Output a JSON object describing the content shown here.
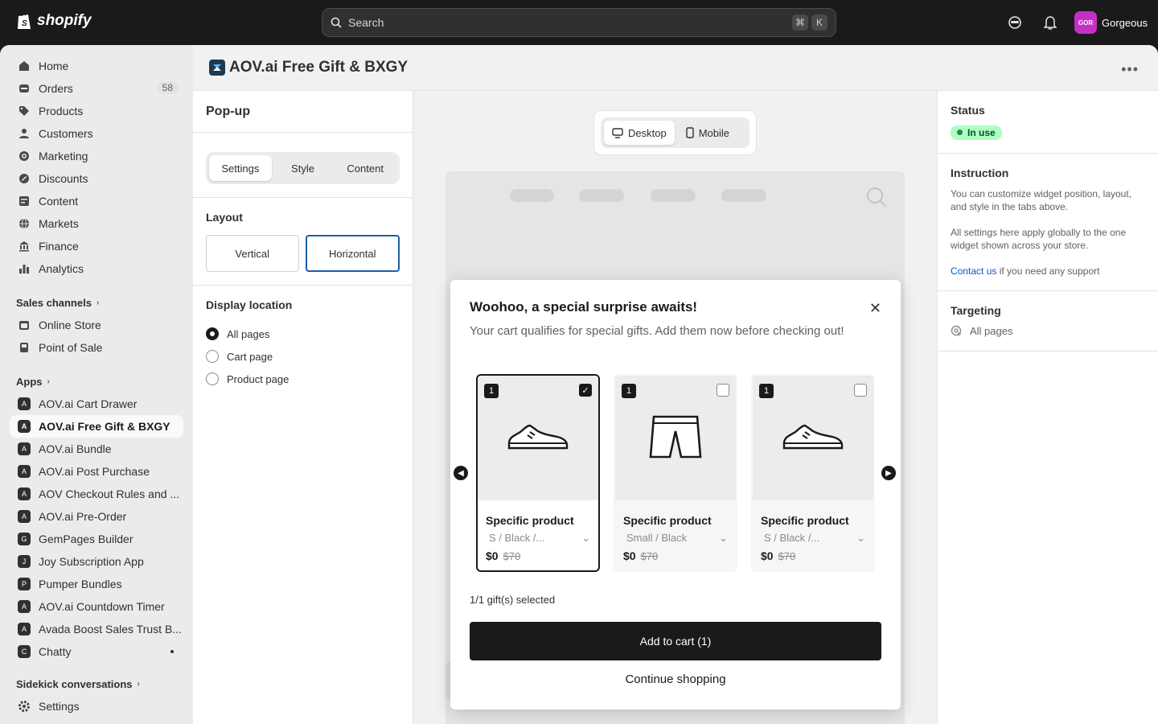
{
  "topbar": {
    "brand": "shopify",
    "search_placeholder": "Search",
    "shortcut_keys": [
      "⌘",
      "K"
    ],
    "store_initials": "GOR",
    "store_name": "Gorgeous",
    "store_color": "#c62fc6"
  },
  "sidebar": {
    "main_items": [
      {
        "label": "Home",
        "icon": "home-icon"
      },
      {
        "label": "Orders",
        "icon": "orders-icon",
        "badge": "58"
      },
      {
        "label": "Products",
        "icon": "tag-icon"
      },
      {
        "label": "Customers",
        "icon": "person-icon"
      },
      {
        "label": "Marketing",
        "icon": "target-icon"
      },
      {
        "label": "Discounts",
        "icon": "discount-icon"
      },
      {
        "label": "Content",
        "icon": "content-icon"
      },
      {
        "label": "Markets",
        "icon": "globe-icon"
      },
      {
        "label": "Finance",
        "icon": "bank-icon"
      },
      {
        "label": "Analytics",
        "icon": "chart-icon"
      }
    ],
    "sales_channels_label": "Sales channels",
    "sales_channels": [
      {
        "label": "Online Store"
      },
      {
        "label": "Point of Sale"
      }
    ],
    "apps_label": "Apps",
    "apps": [
      {
        "label": "AOV.ai Cart Drawer"
      },
      {
        "label": "AOV.ai Free Gift & BXGY"
      },
      {
        "label": "AOV.ai Bundle"
      },
      {
        "label": "AOV.ai Post Purchase"
      },
      {
        "label": "AOV Checkout Rules and ..."
      },
      {
        "label": "AOV.ai Pre-Order"
      },
      {
        "label": "GemPages Builder"
      },
      {
        "label": "Joy Subscription App"
      },
      {
        "label": "Pumper Bundles"
      },
      {
        "label": "AOV.ai Countdown Timer"
      },
      {
        "label": "Avada Boost Sales Trust B..."
      },
      {
        "label": "Chatty"
      }
    ],
    "sidekick_label": "Sidekick conversations",
    "settings_label": "Settings"
  },
  "page": {
    "title": "AOV.ai Free Gift & BXGY"
  },
  "panel": {
    "title": "Pop-up",
    "tabs": [
      "Settings",
      "Style",
      "Content"
    ],
    "active_tab": "Settings",
    "layout_label": "Layout",
    "layout_options": [
      "Vertical",
      "Horizontal"
    ],
    "layout_selected": "Horizontal",
    "display_label": "Display location",
    "display_options": [
      "All pages",
      "Cart page",
      "Product page"
    ],
    "display_selected": "All pages"
  },
  "preview": {
    "devices": [
      "Desktop",
      "Mobile"
    ],
    "active_device": "Desktop",
    "popup": {
      "title": "Woohoo, a special surprise awaits!",
      "subtitle": "Your cart qualifies for special gifts. Add them now before checking out!",
      "products": [
        {
          "qty": "1",
          "name": "Specific product",
          "variant": "S / Black /...",
          "price": "$0",
          "old_price": "$70",
          "selected": true,
          "image": "shoe-icon"
        },
        {
          "qty": "1",
          "name": "Specific product",
          "variant": "Small / Black",
          "price": "$0",
          "old_price": "$70",
          "selected": false,
          "image": "shorts-icon"
        },
        {
          "qty": "1",
          "name": "Specific product",
          "variant": "S / Black /...",
          "price": "$0",
          "old_price": "$70",
          "selected": false,
          "image": "shoe-icon"
        }
      ],
      "selection_count": "1/1 gift(s) selected",
      "add_button": "Add to cart (1)",
      "continue_label": "Continue shopping"
    }
  },
  "right": {
    "status_label": "Status",
    "status_value": "In use",
    "instruction_label": "Instruction",
    "instruction_p1": "You can customize widget position, layout, and style in the tabs above.",
    "instruction_p2": "All settings here apply globally to the one widget shown across your store.",
    "contact_link": "Contact us",
    "contact_rest": " if you need any support",
    "targeting_label": "Targeting",
    "targeting_value": "All pages"
  }
}
